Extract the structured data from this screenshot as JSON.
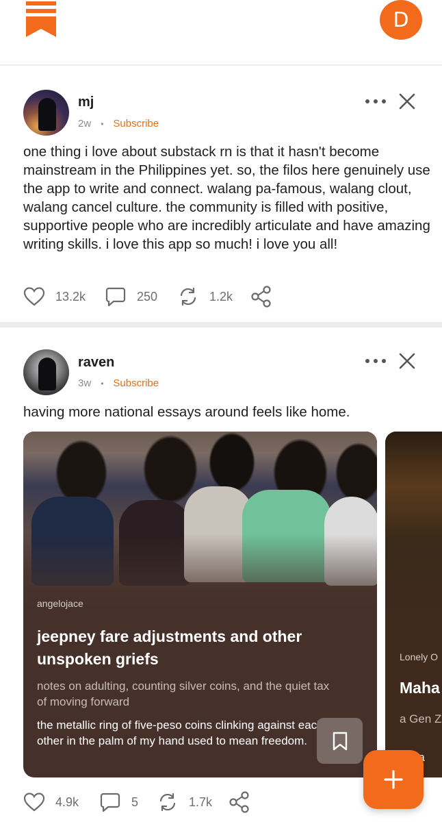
{
  "header": {
    "logo": "substack-logo",
    "avatar_initial": "D"
  },
  "posts": [
    {
      "author": "mj",
      "age": "2w",
      "subscribe_label": "Subscribe",
      "body": "one thing i love about substack rn is that it hasn't become mainstream in the Philippines yet. so, the filos here genuinely use the app to write and connect. walang pa-famous, walang clout, walang cancel culture. the community is filled with positive, supportive people who are incredibly articulate and have amazing writing skills. i love this app so much! i love you all!",
      "likes": "13.2k",
      "comments": "250",
      "restacks": "1.2k"
    },
    {
      "author": "raven",
      "age": "3w",
      "subscribe_label": "Subscribe",
      "body": "having more national essays around feels like home.",
      "likes": "4.9k",
      "comments": "5",
      "restacks": "1.7k",
      "cards": [
        {
          "publication": "angelojace",
          "title": "jeepney fare adjustments and other unspoken griefs",
          "subtitle": "notes on adulting, counting silver coins, and the quiet tax of moving forward",
          "excerpt": "the metallic ring of five-peso coins clinking against each other in the palm of my hand used to mean freedom."
        },
        {
          "publication": "Lonely O",
          "title": "Maha",
          "subtitle": "a Gen Z checks!",
          "excerpt": "hal a"
        }
      ]
    }
  ],
  "colors": {
    "accent": "#f26b1d",
    "subscribe": "#e0701e",
    "card_bg": "#46312a"
  }
}
